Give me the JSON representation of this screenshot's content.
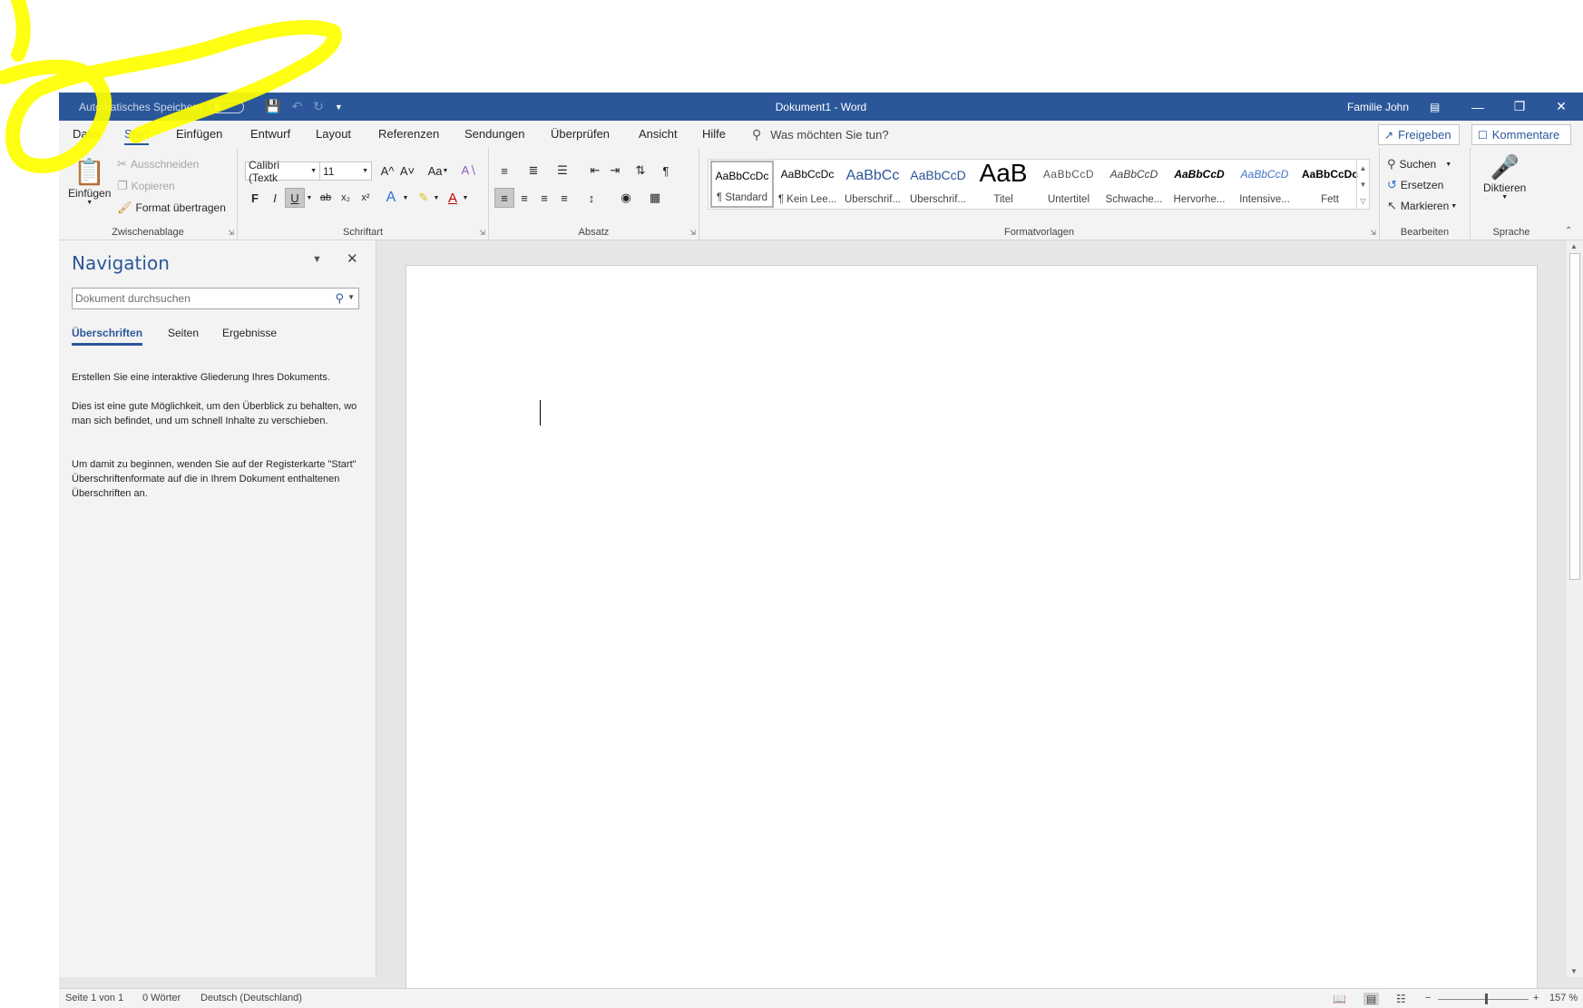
{
  "titlebar": {
    "autosave_label": "Automatisches Speichern",
    "doc_title": "Dokument1  -  Word",
    "user_name": "Familie John"
  },
  "menu_tabs": [
    "Datei",
    "Start",
    "Einfügen",
    "Entwurf",
    "Layout",
    "Referenzen",
    "Sendungen",
    "Überprüfen",
    "Ansicht",
    "Hilfe"
  ],
  "active_tab": "Start",
  "tellme_placeholder": "Was möchten Sie tun?",
  "share_label": "Freigeben",
  "comments_label": "Kommentare",
  "clipboard": {
    "paste": "Einfügen",
    "cut": "Ausschneiden",
    "copy": "Kopieren",
    "format_painter": "Format übertragen",
    "group": "Zwischenablage"
  },
  "font": {
    "name": "Calibri (Textk",
    "size": "11",
    "group": "Schriftart",
    "grow": "A^",
    "shrink": "A˅",
    "case": "Aa",
    "bold": "F",
    "italic": "I",
    "underline": "U",
    "strike": "ab",
    "subscript": "x₂",
    "superscript": "x²"
  },
  "paragraph": {
    "group": "Absatz"
  },
  "styles": {
    "group": "Formatvorlagen",
    "items": [
      {
        "preview": "AaBbCcDc",
        "name": "¶ Standard",
        "color": "#000000"
      },
      {
        "preview": "AaBbCcDc",
        "name": "¶ Kein Lee...",
        "color": "#000000"
      },
      {
        "preview": "AaBbCc",
        "name": "Überschrif...",
        "color": "#2f5496"
      },
      {
        "preview": "AaBbCcD",
        "name": "Überschrif...",
        "color": "#2f5496"
      },
      {
        "preview": "AaB",
        "name": "Titel",
        "color": "#000000"
      },
      {
        "preview": "AaBbCcD",
        "name": "Untertitel",
        "color": "#595959"
      },
      {
        "preview": "AaBbCcD",
        "name": "Schwache...",
        "color": "#404040"
      },
      {
        "preview": "AaBbCcD",
        "name": "Hervorhe...",
        "color": "#000000"
      },
      {
        "preview": "AaBbCcD",
        "name": "Intensive...",
        "color": "#4472c4"
      },
      {
        "preview": "AaBbCcDc",
        "name": "Fett",
        "color": "#000000"
      }
    ]
  },
  "editing": {
    "group": "Bearbeiten",
    "find": "Suchen",
    "replace": "Ersetzen",
    "select": "Markieren"
  },
  "voice": {
    "group": "Sprache",
    "dictate": "Diktieren"
  },
  "navigation": {
    "title": "Navigation",
    "search_placeholder": "Dokument durchsuchen",
    "tabs": [
      "Überschriften",
      "Seiten",
      "Ergebnisse"
    ],
    "text1": "Erstellen Sie eine interaktive Gliederung Ihres Dokuments.",
    "text2": "Dies ist eine gute Möglichkeit, um den Überblick zu behalten, wo man sich befindet, und um schnell Inhalte zu verschieben.",
    "text3": "Um damit zu beginnen, wenden Sie auf der Registerkarte \"Start\" Überschriftenformate auf die in Ihrem Dokument enthaltenen Überschriften an."
  },
  "status": {
    "page": "Seite 1 von 1",
    "words": "0 Wörter",
    "language": "Deutsch (Deutschland)",
    "zoom": "157 %"
  },
  "colors": {
    "accent": "#2b579a",
    "scribble": "#ffff00"
  }
}
